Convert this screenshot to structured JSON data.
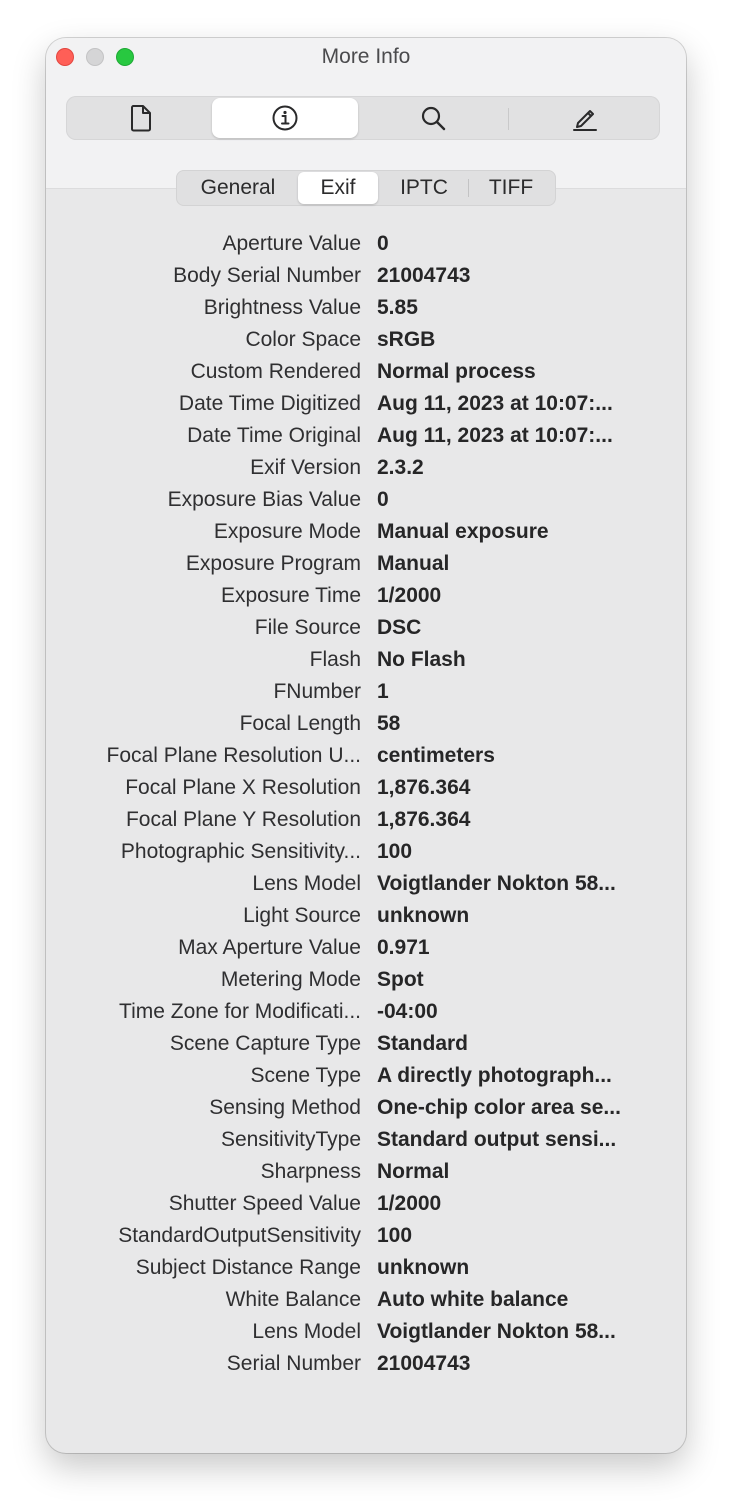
{
  "window": {
    "title": "More Info"
  },
  "toolbar": {
    "buttons": [
      {
        "name": "document-icon",
        "selected": false
      },
      {
        "name": "info-icon",
        "selected": true
      },
      {
        "name": "search-icon",
        "selected": false
      },
      {
        "name": "pencil-icon",
        "selected": false
      }
    ]
  },
  "tabs": {
    "items": [
      "General",
      "Exif",
      "IPTC",
      "TIFF"
    ],
    "selected": "Exif"
  },
  "exif": {
    "rows": [
      {
        "label": "Aperture Value",
        "value": "0"
      },
      {
        "label": "Body Serial Number",
        "value": "21004743"
      },
      {
        "label": "Brightness Value",
        "value": "5.85"
      },
      {
        "label": "Color Space",
        "value": "sRGB"
      },
      {
        "label": "Custom Rendered",
        "value": "Normal process"
      },
      {
        "label": "Date Time Digitized",
        "value": "Aug 11, 2023 at 10:07:..."
      },
      {
        "label": "Date Time Original",
        "value": "Aug 11, 2023 at 10:07:..."
      },
      {
        "label": "Exif Version",
        "value": "2.3.2"
      },
      {
        "label": "Exposure Bias Value",
        "value": "0"
      },
      {
        "label": "Exposure Mode",
        "value": "Manual exposure"
      },
      {
        "label": "Exposure Program",
        "value": "Manual"
      },
      {
        "label": "Exposure Time",
        "value": "1/2000"
      },
      {
        "label": "File Source",
        "value": "DSC"
      },
      {
        "label": "Flash",
        "value": "No Flash"
      },
      {
        "label": "FNumber",
        "value": "1"
      },
      {
        "label": "Focal Length",
        "value": "58"
      },
      {
        "label": "Focal Plane Resolution U...",
        "value": "centimeters"
      },
      {
        "label": "Focal Plane X Resolution",
        "value": "1,876.364"
      },
      {
        "label": "Focal Plane Y Resolution",
        "value": "1,876.364"
      },
      {
        "label": "Photographic Sensitivity...",
        "value": "100"
      },
      {
        "label": "Lens Model",
        "value": "Voigtlander Nokton 58..."
      },
      {
        "label": "Light Source",
        "value": "unknown"
      },
      {
        "label": "Max Aperture Value",
        "value": "0.971"
      },
      {
        "label": "Metering Mode",
        "value": "Spot"
      },
      {
        "label": "Time Zone for Modificati...",
        "value": "-04:00"
      },
      {
        "label": "Scene Capture Type",
        "value": "Standard"
      },
      {
        "label": "Scene Type",
        "value": "A directly photograph..."
      },
      {
        "label": "Sensing Method",
        "value": "One-chip color area se..."
      },
      {
        "label": "SensitivityType",
        "value": "Standard output sensi..."
      },
      {
        "label": "Sharpness",
        "value": "Normal"
      },
      {
        "label": "Shutter Speed Value",
        "value": "1/2000"
      },
      {
        "label": "StandardOutputSensitivity",
        "value": "100"
      },
      {
        "label": "Subject Distance Range",
        "value": "unknown"
      },
      {
        "label": "White Balance",
        "value": "Auto white balance"
      },
      {
        "label": "Lens Model",
        "value": "Voigtlander Nokton 58..."
      },
      {
        "label": "Serial Number",
        "value": "21004743"
      }
    ]
  }
}
